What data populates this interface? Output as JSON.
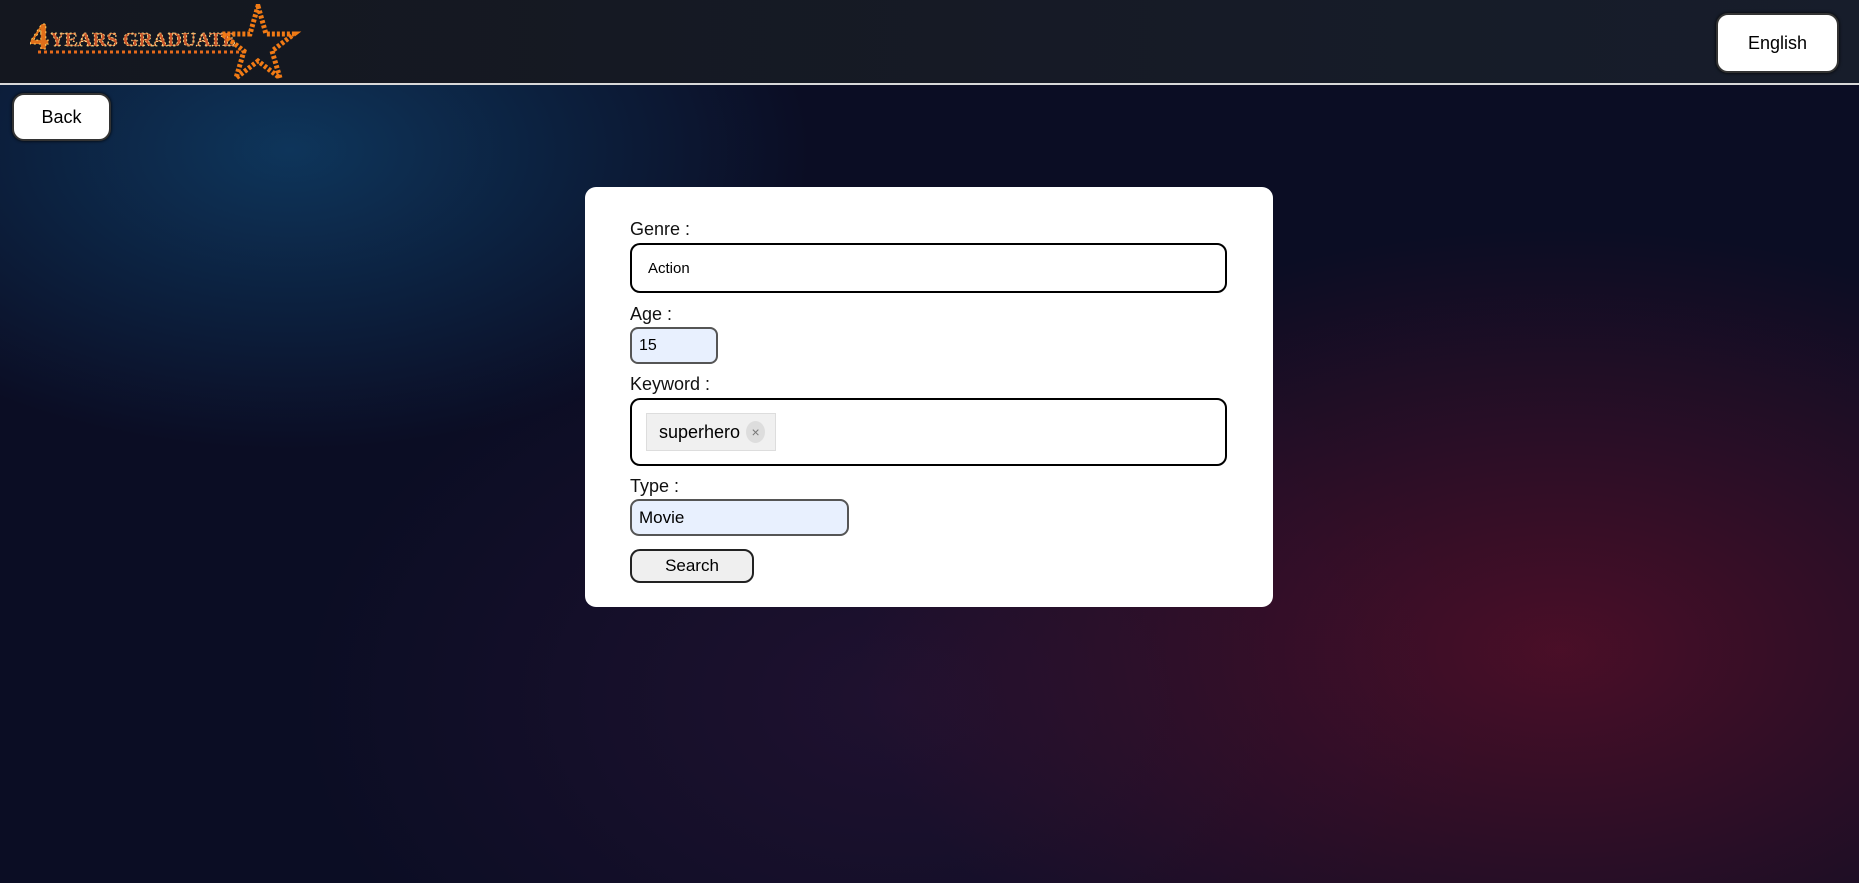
{
  "header": {
    "logo_text": "4YEARS GRADUATE",
    "language_label": "English"
  },
  "nav": {
    "back_label": "Back"
  },
  "form": {
    "genre": {
      "label": "Genre :",
      "value": "Action"
    },
    "age": {
      "label": "Age :",
      "value": "15"
    },
    "keyword": {
      "label": "Keyword :",
      "chips": [
        {
          "text": "superhero",
          "remove_icon": "×"
        }
      ]
    },
    "type": {
      "label": "Type :",
      "value": "Movie"
    },
    "search_label": "Search"
  }
}
